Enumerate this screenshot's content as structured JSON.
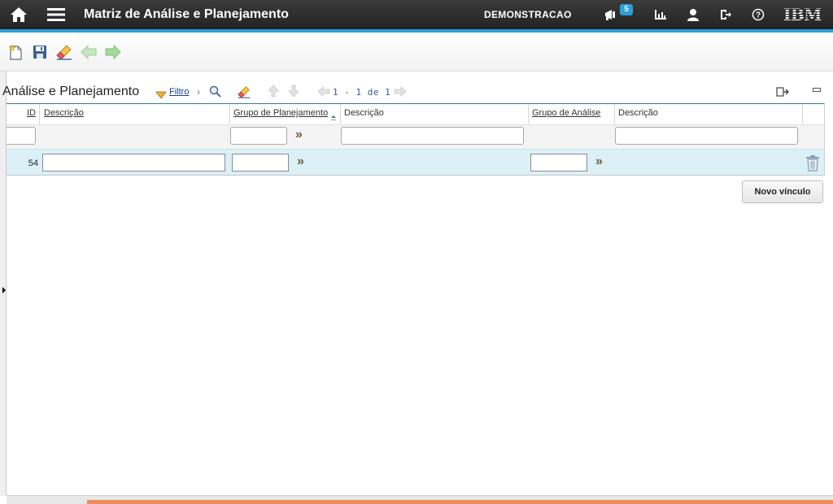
{
  "topbar": {
    "title": "Matriz de Análise e Planejamento",
    "user": "DEMONSTRACAO",
    "notifications_count": "5",
    "logo": "IBM",
    "icons": [
      "home-icon",
      "menu-icon",
      "megaphone-icon",
      "chart-icon",
      "user-icon",
      "signout-icon",
      "help-icon"
    ],
    "accent_color": "#2d9fd9"
  },
  "toolbar": {
    "buttons": [
      "new-record-icon",
      "save-icon",
      "clear-icon",
      "previous-arrow-icon",
      "next-arrow-icon"
    ]
  },
  "section": {
    "title": "Análise e Planejamento",
    "filter_label": "Filtro",
    "pager": {
      "start": "1",
      "separator": "-",
      "end": "1",
      "of_label": "de",
      "total": "1"
    }
  },
  "table": {
    "columns": [
      "ID",
      "Descrição",
      "Grupo de Planejamento",
      "Descrição",
      "Grupo de Análise",
      "Descrição"
    ],
    "rows": [
      {
        "id": "54",
        "descricao": "",
        "grupo_planejamento": "",
        "descricao_planejamento": "",
        "grupo_analise": "",
        "descricao_analise": ""
      }
    ]
  },
  "actions": {
    "novo_vinculo": "Novo vínculo"
  }
}
